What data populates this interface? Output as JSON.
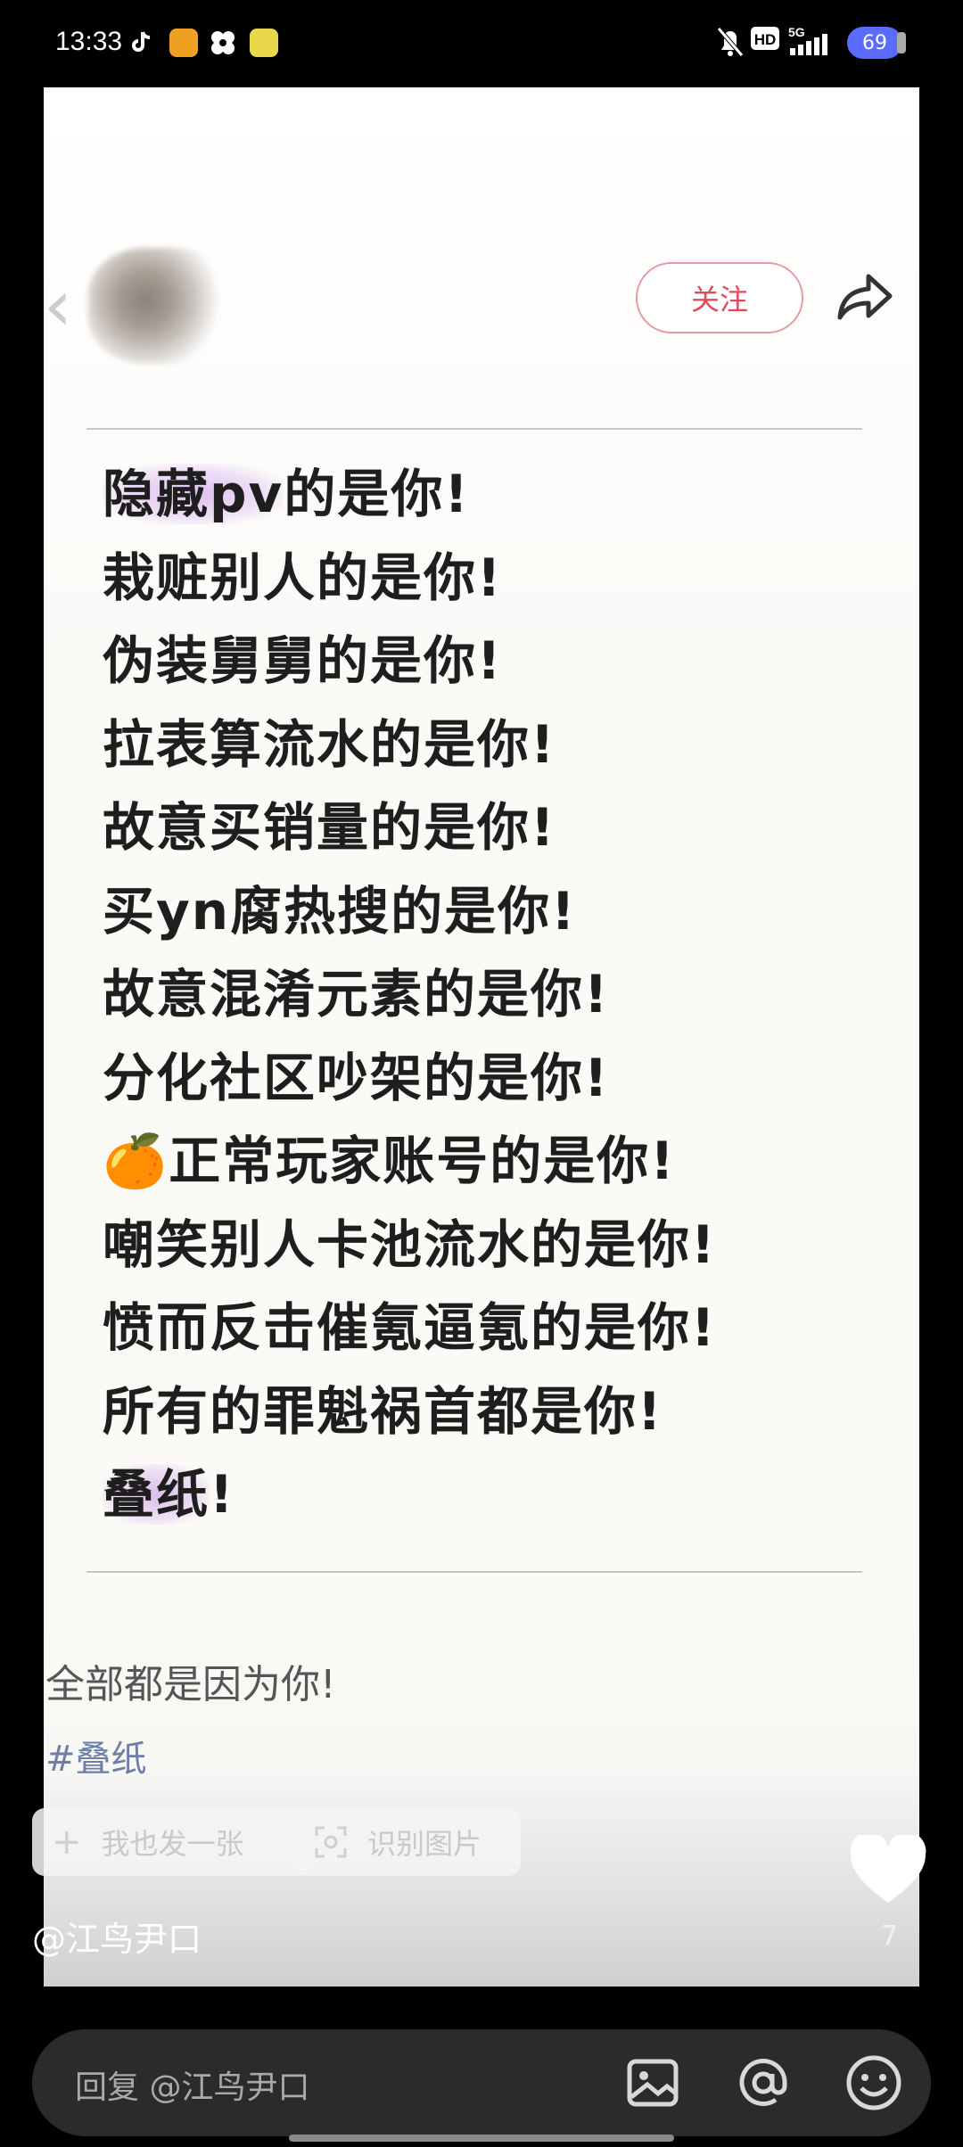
{
  "status_bar": {
    "time": "13:33",
    "app_icons": [
      "tiktok-icon",
      "app-orange-icon",
      "app-pinwheel-icon",
      "app-green-icon"
    ],
    "system_icons": [
      "bell-muted-icon",
      "hd-icon",
      "5g-signal-icon"
    ],
    "battery": "69"
  },
  "post": {
    "follow_label": "关注",
    "lines": [
      {
        "pre": "",
        "hl": "隐藏pv",
        "post": "的是你!"
      },
      {
        "pre": "栽赃别人的是你!",
        "hl": "",
        "post": ""
      },
      {
        "pre": "伪装舅舅的是你!",
        "hl": "",
        "post": ""
      },
      {
        "pre": "拉表算流水的是你!",
        "hl": "",
        "post": ""
      },
      {
        "pre": "故意买销量的是你!",
        "hl": "",
        "post": ""
      },
      {
        "pre": "买yn腐热搜的是你!",
        "hl": "",
        "post": ""
      },
      {
        "pre": "故意混淆元素的是你!",
        "hl": "",
        "post": ""
      },
      {
        "pre": "分化社区吵架的是你!",
        "hl": "",
        "post": ""
      },
      {
        "pre": "🍊正常玩家账号的是你!",
        "hl": "",
        "post": ""
      },
      {
        "pre": "嘲笑别人卡池流水的是你!",
        "hl": "",
        "post": ""
      },
      {
        "pre": "愤而反击催氪逼氪的是你!",
        "hl": "",
        "post": ""
      },
      {
        "pre": "所有的罪魁祸首都是你!",
        "hl": "",
        "post": ""
      },
      {
        "pre": "",
        "hl": "叠纸",
        "post": "!"
      }
    ],
    "caption": "全部都是因为你!",
    "hashtag": "#叠纸",
    "action_post_label": "我也发一张",
    "action_recognize_label": "识别图片",
    "like_count": "7",
    "author_handle": "@江鸟尹口"
  },
  "reply_bar": {
    "placeholder": "回复 @江鸟尹口",
    "icons": [
      "image-icon",
      "at-icon",
      "emoji-icon"
    ]
  }
}
